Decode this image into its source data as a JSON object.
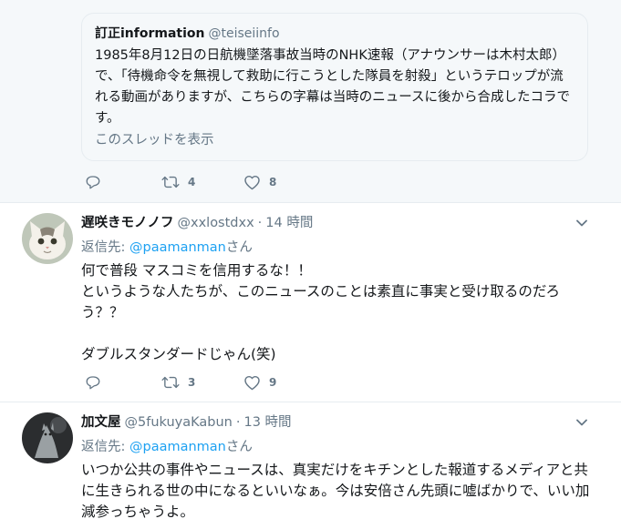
{
  "quoted": {
    "name": "訂正information",
    "handle": "@teiseiinfo",
    "text": "1985年8月12日の日航機墜落事故当時のNHK速報（アナウンサーは木村太郎）で、「待機命令を無視して救助に行こうとした隊員を射殺」というテロップが流れる動画がありますが、こちらの字幕は当時のニュースに後から合成したコラです。",
    "thread_link": "このスレッドを表示"
  },
  "first_actions": {
    "retweets": "4",
    "likes": "8"
  },
  "tweets": [
    {
      "name": "遅咲きモノノフ",
      "handle": "@xxlostdxx",
      "separator": "·",
      "time": "14 時間",
      "reply_prefix": "返信先: ",
      "reply_mention": "@paamanman",
      "reply_suffix": "さん",
      "body": [
        "何で普段 マスコミを信用するな！！",
        "というような人たちが、このニュースのことは素直に事実と受け取るのだろう？？",
        "",
        "ダブルスタンダードじゃん(笑)"
      ],
      "retweets": "3",
      "likes": "9"
    },
    {
      "name": "加文屋",
      "handle": "@5fukuyaKabun",
      "separator": "·",
      "time": "13 時間",
      "reply_prefix": "返信先: ",
      "reply_mention": "@paamanman",
      "reply_suffix": "さん",
      "body": [
        "いつか公共の事件やニュースは、真実だけをキチンとした報道するメディアと共に生きられる世の中になるといいなぁ。今は安倍さん先頭に嘘ばかりで、いい加減参っちゃうよ。"
      ]
    }
  ],
  "colors": {
    "accent": "#1da1f2",
    "secondary_text": "#657786",
    "border": "#e6ecf0",
    "background_highlight": "#f5f8fa"
  },
  "icons": [
    "reply-icon",
    "retweet-icon",
    "like-icon",
    "chevron-down-icon"
  ]
}
